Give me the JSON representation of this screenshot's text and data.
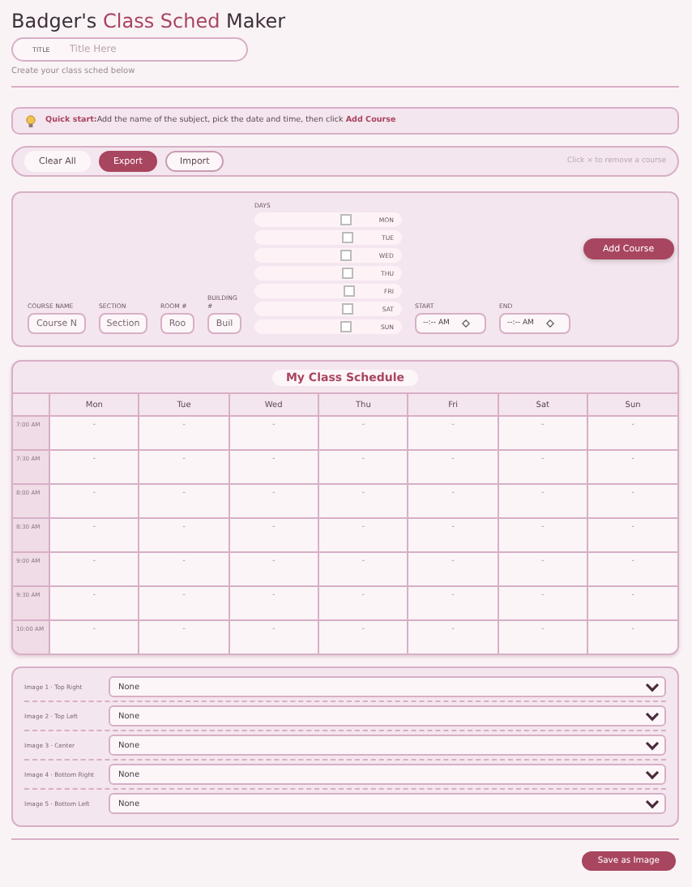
{
  "header": {
    "title_prefix": "Badger's",
    "title_accent": "Class Sched",
    "title_suffix": "Maker",
    "title_field": {
      "label": "TITLE",
      "placeholder": "Title Here"
    },
    "subtitle": "Create your class sched below"
  },
  "quick_start": {
    "text": "**Quick start:**Add the name of the subject, pick the date and time, then click **Add Course**"
  },
  "toolbar": {
    "buttons": [
      {
        "label": "Clear All",
        "kind": "soft"
      },
      {
        "label": "Export",
        "kind": "primary"
      },
      {
        "label": "Import",
        "kind": "outline"
      }
    ],
    "hint": "Click × to remove a course"
  },
  "form": {
    "fields": [
      {
        "label": "COURSE NAME",
        "placeholder": "Course N"
      },
      {
        "label": "SECTION",
        "placeholder": "Section"
      },
      {
        "label": "ROOM #",
        "placeholder": "Roo"
      },
      {
        "label": "BUILDING #",
        "placeholder": "Buil"
      }
    ],
    "days_label": "DAYS",
    "days": [
      {
        "label": "MON",
        "checked": false
      },
      {
        "label": "TUE",
        "checked": false
      },
      {
        "label": "WED",
        "checked": false
      },
      {
        "label": "THU",
        "checked": false
      },
      {
        "label": "FRI",
        "checked": false
      },
      {
        "label": "SAT",
        "checked": false
      },
      {
        "label": "SUN",
        "checked": false
      }
    ],
    "start": {
      "label": "START",
      "value": "--:-- AM"
    },
    "end": {
      "label": "END",
      "value": "--:-- AM"
    },
    "add_button": "Add Course"
  },
  "schedule": {
    "title": "My Class Schedule",
    "days": [
      "Mon",
      "Tue",
      "Wed",
      "Thu",
      "Fri",
      "Sat",
      "Sun"
    ],
    "rows": [
      {
        "time": "7:00 AM",
        "cells": [
          "-",
          "-",
          "-",
          "-",
          "-",
          "-",
          "-"
        ]
      },
      {
        "time": "7:30 AM",
        "cells": [
          "-",
          "-",
          "-",
          "-",
          "-",
          "-",
          "-"
        ]
      },
      {
        "time": "8:00 AM",
        "cells": [
          "-",
          "-",
          "-",
          "-",
          "-",
          "-",
          "-"
        ]
      },
      {
        "time": "8:30 AM",
        "cells": [
          "-",
          "-",
          "-",
          "-",
          "-",
          "-",
          "-"
        ]
      },
      {
        "time": "9:00 AM",
        "cells": [
          "-",
          "-",
          "-",
          "-",
          "-",
          "-",
          "-"
        ]
      },
      {
        "time": "9:30 AM",
        "cells": [
          "-",
          "-",
          "-",
          "-",
          "-",
          "-",
          "-"
        ]
      },
      {
        "time": "10:00 AM",
        "cells": [
          "-",
          "-",
          "-",
          "-",
          "-",
          "-",
          "-"
        ]
      }
    ]
  },
  "images": [
    {
      "label": "Image 1 · Top Right",
      "value": "None"
    },
    {
      "label": "Image 2 · Top Left",
      "value": "None"
    },
    {
      "label": "Image 3 · Center",
      "value": "None"
    },
    {
      "label": "Image 4 · Bottom Right",
      "value": "None"
    },
    {
      "label": "Image 5 · Bottom Left",
      "value": "None"
    }
  ],
  "save_button": "Save as Image"
}
